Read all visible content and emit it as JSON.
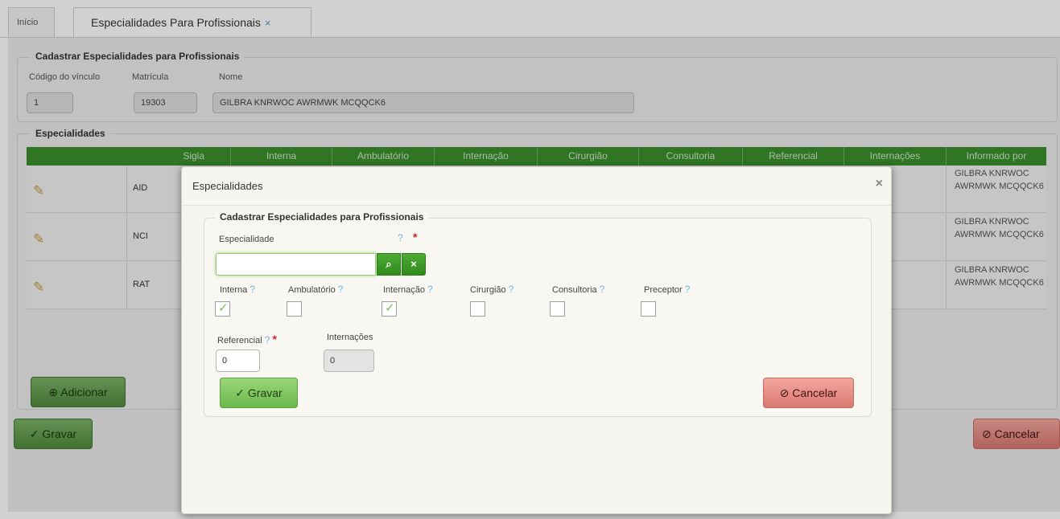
{
  "tabs": {
    "home": "Início",
    "active": "Especialidades Para Profissionais",
    "close": "×"
  },
  "main": {
    "section_title": "Cadastrar Especialidades para Profissionais",
    "fields": {
      "codigo_label": "Código do vínculo",
      "codigo_value": "1",
      "matricula_label": "Matrícula",
      "matricula_value": "19303",
      "nome_label": "Nome",
      "nome_value": "GILBRA KNRWOC AWRMWK MCQQCK6"
    },
    "especialidades_title": "Especialidades",
    "columns": [
      "Sigla",
      "Interna",
      "Ambulatório",
      "Internação",
      "Cirurgião",
      "Consultoria",
      "Referencial",
      "Internações",
      "Informado por"
    ],
    "rows": [
      {
        "sigla": "AID",
        "informado": "GILBRA KNRWOC AWRMWK MCQQCK6"
      },
      {
        "sigla": "NCI",
        "informado": "GILBRA KNRWOC AWRMWK MCQQCK6"
      },
      {
        "sigla": "RAT",
        "informado": "GILBRA KNRWOC AWRMWK MCQQCK6"
      }
    ],
    "add_button": "Adicionar",
    "save_button": "Gravar",
    "cancel_button": "Cancelar"
  },
  "modal": {
    "title": "Especialidades",
    "close": "×",
    "section_title": "Cadastrar Especialidades para Profissionais",
    "especialidade_label": "Especialidade",
    "especialidade_value": "",
    "checkboxes": [
      {
        "label": "Interna",
        "checked": true
      },
      {
        "label": "Ambulatório",
        "checked": false
      },
      {
        "label": "Internação",
        "checked": true
      },
      {
        "label": "Cirurgião",
        "checked": false
      },
      {
        "label": "Consultoria",
        "checked": false
      },
      {
        "label": "Preceptor",
        "checked": false
      }
    ],
    "referencial_label": "Referencial",
    "referencial_value": "0",
    "internacoes_label": "Internações",
    "internacoes_value": "0",
    "save_button": "Gravar",
    "cancel_button": "Cancelar"
  },
  "colors": {
    "header_green": "#3a8f2c",
    "button_green": "#6ab84a",
    "button_red": "#d9786f",
    "help_blue": "#6fb3dc",
    "required_red": "#d42020"
  }
}
